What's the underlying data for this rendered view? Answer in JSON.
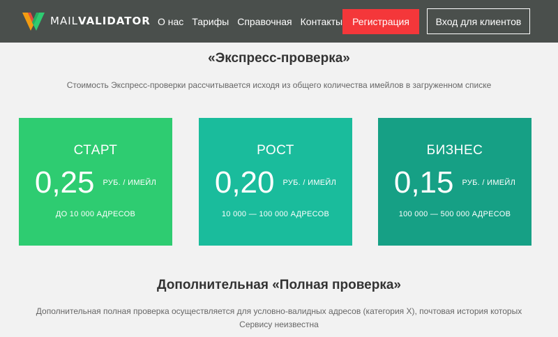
{
  "header": {
    "logo": {
      "light": "MAIL",
      "bold": "VALIDATOR"
    },
    "nav": [
      {
        "label": "О нас"
      },
      {
        "label": "Тарифы"
      },
      {
        "label": "Справочная"
      },
      {
        "label": "Контакты"
      }
    ],
    "register_label": "Регистрация",
    "login_label": "Вход для клиентов"
  },
  "express": {
    "title": "«Экспресс-проверка»",
    "description": "Стоимость Экспресс-проверки рассчитывается исходя из общего количества имейлов в загруженном списке",
    "plans": [
      {
        "name": "СТАРТ",
        "price": "0,25",
        "unit": "РУБ. / ИМЕЙЛ",
        "range": "ДО 10 000 АДРЕСОВ",
        "color": "#2ecc71"
      },
      {
        "name": "РОСТ",
        "price": "0,20",
        "unit": "РУБ. / ИМЕЙЛ",
        "range": "10 000 — 100 000 АДРЕСОВ",
        "color": "#1abc9c"
      },
      {
        "name": "БИЗНЕС",
        "price": "0,15",
        "unit": "РУБ. / ИМЕЙЛ",
        "range": "100 000 — 500 000 АДРЕСОВ",
        "color": "#16a085"
      }
    ]
  },
  "full": {
    "title": "Дополнительная «Полная проверка»",
    "description_line1": "Дополнительная полная проверка осуществляется для условно-валидных адресов (категория X), почтовая история которых",
    "description_line2": "Сервису неизвестна"
  },
  "colors": {
    "header_bg": "#4a4f4c",
    "register_bg": "#f4373a",
    "page_bg": "#f2f2f2"
  }
}
